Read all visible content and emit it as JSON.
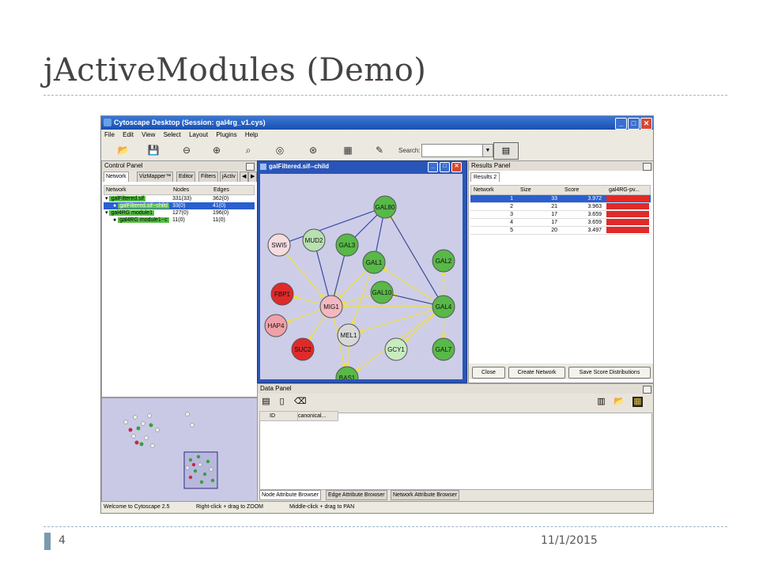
{
  "slide": {
    "title": "jActiveModules (Demo)",
    "page_number": "4",
    "date": "11/1/2015"
  },
  "app": {
    "window_title": "Cytoscape Desktop (Session: gal4rg_v1.cys)",
    "menu": [
      "File",
      "Edit",
      "View",
      "Select",
      "Layout",
      "Plugins",
      "Help"
    ],
    "search_label": "Search:",
    "search_value": "",
    "status_left": "Welcome to Cytoscape 2.5",
    "status_mid": "Right-click + drag to ZOOM",
    "status_right": "Middle-click + drag to PAN"
  },
  "control_panel": {
    "title": "Control Panel",
    "tabs": [
      "Network",
      "VizMapper™",
      "Editor",
      "Filters",
      "jActiv"
    ],
    "columns": [
      "Network",
      "Nodes",
      "Edges"
    ],
    "rows": [
      {
        "name": "galFiltered.sif",
        "nodes": "331(33)",
        "edges": "362(0)"
      },
      {
        "name": "galFiltered.sif--child",
        "nodes": "33(0)",
        "edges": "41(0)"
      },
      {
        "name": "gal4RG module1",
        "nodes": "127(0)",
        "edges": "196(0)"
      },
      {
        "name": "gal4RG module1--c",
        "nodes": "11(0)",
        "edges": "11(0)"
      }
    ]
  },
  "network_window": {
    "title": "galFiltered.sif--child",
    "nodes": [
      {
        "id": "GAL80",
        "color": "#58b848"
      },
      {
        "id": "SWI5",
        "color": "#f4dce0"
      },
      {
        "id": "MUD2",
        "color": "#b8e0b0"
      },
      {
        "id": "GAL3",
        "color": "#58b848"
      },
      {
        "id": "GAL1",
        "color": "#58b848"
      },
      {
        "id": "GAL2",
        "color": "#58b848"
      },
      {
        "id": "FBP1",
        "color": "#e02a2a"
      },
      {
        "id": "MIG1",
        "color": "#f4b8c0"
      },
      {
        "id": "GAL10",
        "color": "#58b848"
      },
      {
        "id": "GAL4",
        "color": "#58b848"
      },
      {
        "id": "HAP4",
        "color": "#f0a0a8"
      },
      {
        "id": "MEL1",
        "color": "#d8d8d8"
      },
      {
        "id": "GCY1",
        "color": "#c8ecc0"
      },
      {
        "id": "SUC2",
        "color": "#e02a2a"
      },
      {
        "id": "GAL7",
        "color": "#58b848"
      },
      {
        "id": "BAS1",
        "color": "#58b848"
      }
    ]
  },
  "results_panel": {
    "title": "Results Panel",
    "tab": "Results 2",
    "columns": [
      "Network",
      "Size",
      "Score",
      "gal4RG-pv..."
    ],
    "rows": [
      {
        "network": "1",
        "size": "33",
        "score": "3.972"
      },
      {
        "network": "2",
        "size": "21",
        "score": "3.963"
      },
      {
        "network": "3",
        "size": "17",
        "score": "3.659"
      },
      {
        "network": "4",
        "size": "17",
        "score": "3.659"
      },
      {
        "network": "5",
        "size": "20",
        "score": "3.497"
      }
    ],
    "buttons": {
      "close": "Close",
      "create_network": "Create Network",
      "save_scores": "Save Score Distributions"
    }
  },
  "data_panel": {
    "title": "Data Panel",
    "columns": [
      "ID",
      "canonical..."
    ],
    "tabs": [
      "Node Attribute Browser",
      "Edge Attribute Browser",
      "Network Attribute Browser"
    ]
  }
}
